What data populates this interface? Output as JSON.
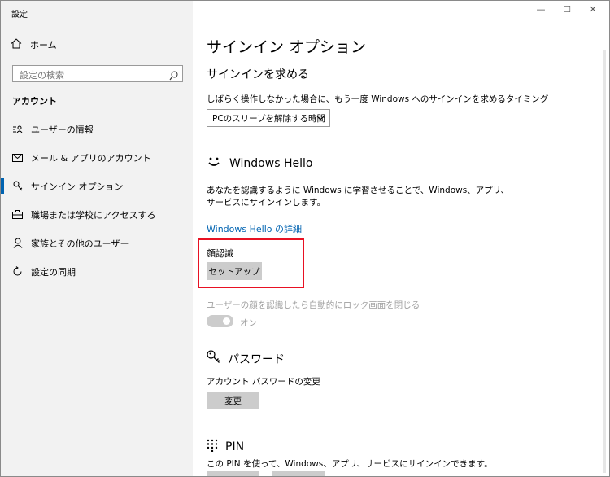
{
  "window": {
    "title": "設定"
  },
  "sidebar": {
    "home_label": "ホーム",
    "search_placeholder": "設定の検索",
    "section_label": "アカウント",
    "items": [
      {
        "label": "ユーザーの情報",
        "icon": "user-card-icon"
      },
      {
        "label": "メール & アプリのアカウント",
        "icon": "mail-icon"
      },
      {
        "label": "サインイン オプション",
        "icon": "key-icon",
        "active": true
      },
      {
        "label": "職場または学校にアクセスする",
        "icon": "briefcase-icon"
      },
      {
        "label": "家族とその他のユーザー",
        "icon": "person-icon"
      },
      {
        "label": "設定の同期",
        "icon": "sync-icon"
      }
    ]
  },
  "main": {
    "page_title": "サインイン オプション",
    "require_signin": {
      "heading": "サインインを求める",
      "description": "しばらく操作しなかった場合に、もう一度 Windows へのサインインを求めるタイミング",
      "dropdown_value": "PCのスリープを解除する時間"
    },
    "hello": {
      "heading": "Windows Hello",
      "description_line1": "あなたを認識するように Windows に学習させることで、Windows、アプリ、",
      "description_line2": "サービスにサインインします。",
      "link": "Windows Hello の詳細",
      "face_label": "顔認識",
      "setup_button": "セットアップ",
      "auto_unlock_label": "ユーザーの顔を認識したら自動的にロック画面を閉じる",
      "toggle_state": "オン",
      "highlight_color": "#e81123"
    },
    "password": {
      "heading": "パスワード",
      "change_label": "アカウント パスワードの変更",
      "change_button": "変更"
    },
    "pin": {
      "heading": "PIN",
      "description": "この PIN を使って、Windows、アプリ、サービスにサインインできます。"
    }
  },
  "colors": {
    "accent": "#0063b1",
    "sidebar_bg": "#f2f2f2",
    "button_bg": "#cccccc"
  }
}
